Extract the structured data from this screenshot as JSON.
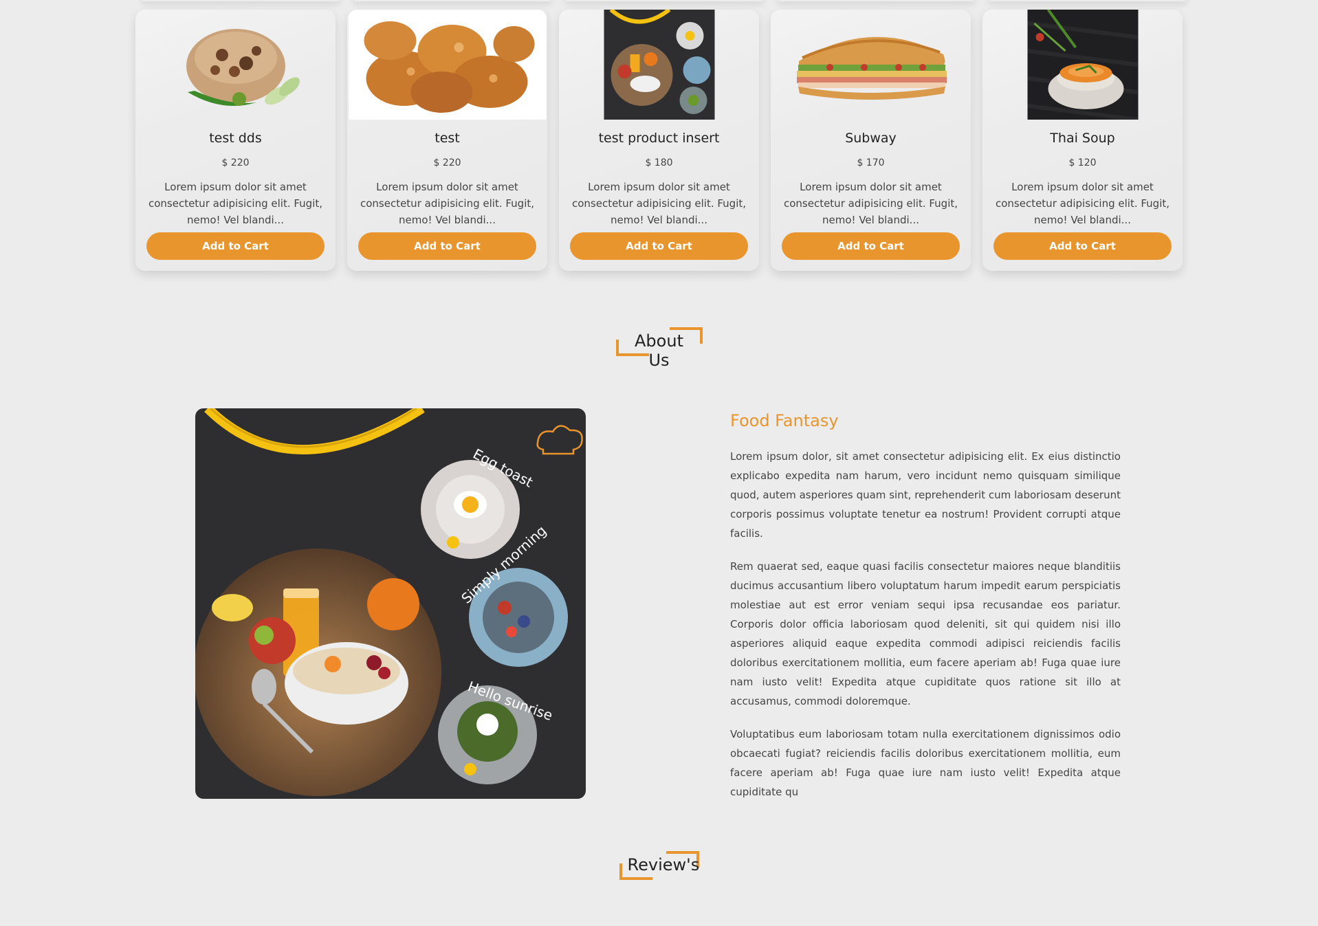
{
  "products": [
    {
      "name": "test dds",
      "price": "$ 220",
      "description": "Lorem ipsum dolor sit amet consectetur adipisicing elit. Fugit, nemo! Vel blandi...",
      "button": "Add to Cart",
      "image": "rice-pilaf-image"
    },
    {
      "name": "test",
      "price": "$ 220",
      "description": "Lorem ipsum dolor sit amet consectetur adipisicing elit. Fugit, nemo! Vel blandi...",
      "button": "Add to Cart",
      "image": "fried-chicken-image"
    },
    {
      "name": "test product insert",
      "price": "$ 180",
      "description": "Lorem ipsum dolor sit amet consectetur adipisicing elit. Fugit, nemo! Vel blandi...",
      "button": "Add to Cart",
      "image": "breakfast-poster-image"
    },
    {
      "name": "Subway",
      "price": "$ 170",
      "description": "Lorem ipsum dolor sit amet consectetur adipisicing elit. Fugit, nemo! Vel blandi...",
      "button": "Add to Cart",
      "image": "sub-sandwich-image"
    },
    {
      "name": "Thai Soup",
      "price": "$ 120",
      "description": "Lorem ipsum dolor sit amet consectetur adipisicing elit. Fugit, nemo! Vel blandi...",
      "button": "Add to Cart",
      "image": "thai-soup-image"
    }
  ],
  "about": {
    "heading": "About Us",
    "title": "Food Fantasy",
    "paragraphs": [
      "Lorem ipsum dolor, sit amet consectetur adipisicing elit. Ex eius distinctio explicabo expedita nam harum, vero incidunt nemo quisquam similique quod, autem asperiores quam sint, reprehenderit cum laboriosam deserunt corporis possimus voluptate tenetur ea nostrum! Provident corrupti atque facilis.",
      "Rem quaerat sed, eaque quasi facilis consectetur maiores neque blanditiis ducimus accusantium libero voluptatum harum impedit earum perspiciatis molestiae aut est error veniam sequi ipsa recusandae eos pariatur. Corporis dolor officia laboriosam quod deleniti, sit qui quidem nisi illo asperiores aliquid eaque expedita commodi adipisci reiciendis facilis doloribus exercitationem mollitia, eum facere aperiam ab! Fuga quae iure nam iusto velit! Expedita atque cupiditate quos ratione sit illo at accusamus, commodi doloremque.",
      "Voluptatibus eum laboriosam totam nulla exercitationem dignissimos odio obcaecati fugiat? reiciendis facilis doloribus exercitationem mollitia, eum facere aperiam ab! Fuga quae iure nam iusto velit! Expedita atque cupiditate qu"
    ],
    "image_labels": [
      "Egg toast",
      "Simply morning",
      "Hello sunrise"
    ]
  },
  "reviews": {
    "heading": "Review's"
  },
  "colors": {
    "accent": "#e8952d",
    "background": "#ececec",
    "poster_bg": "#2e2d30",
    "poster_ring": "#f5c211"
  }
}
